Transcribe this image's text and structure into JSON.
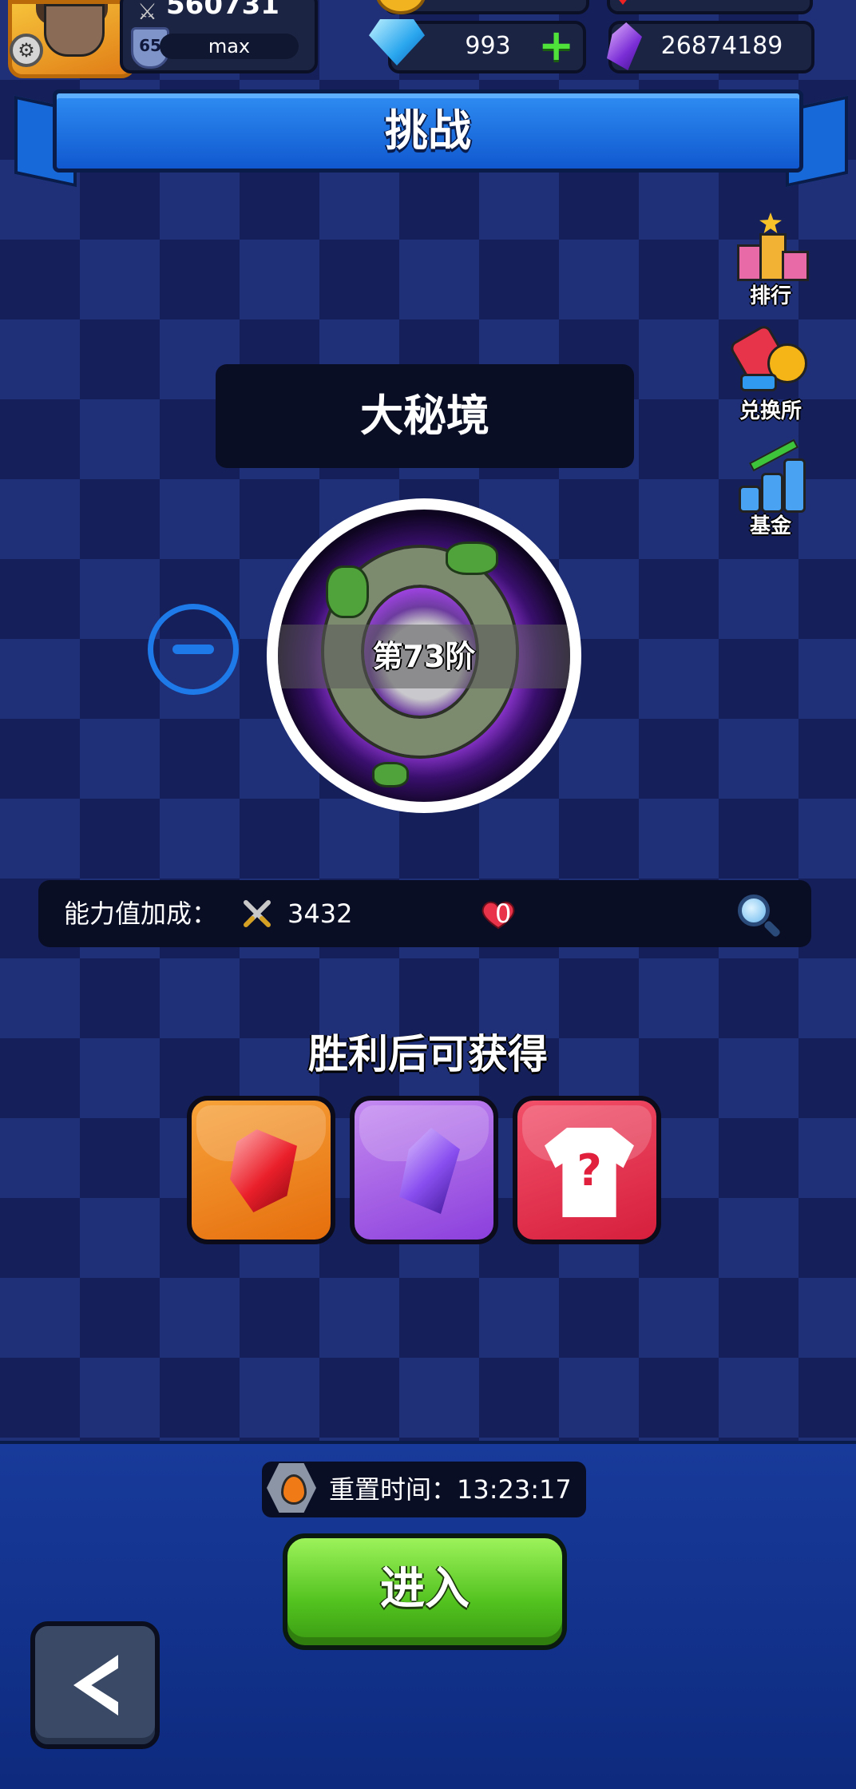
{
  "hud": {
    "power": "560731",
    "level": "65",
    "level_status": "max",
    "diamonds": "993",
    "crystals": "26874189"
  },
  "title": "挑战",
  "side_menu": [
    {
      "label": "排行",
      "icon": "podium-icon"
    },
    {
      "label": "兑换所",
      "icon": "exchange-icon"
    },
    {
      "label": "基金",
      "icon": "fund-chart-icon"
    }
  ],
  "mode": {
    "name": "大秘境",
    "tier": "第73阶"
  },
  "stats": {
    "label": "能力值加成：",
    "attack_bonus": "3432",
    "hp_bonus": "0"
  },
  "rewards": {
    "title": "胜利后可获得",
    "items": [
      {
        "icon": "red-crystal-icon",
        "color": "#f08a1c"
      },
      {
        "icon": "purple-crystal-icon",
        "color": "#9b4fe0"
      },
      {
        "icon": "mystery-armor-icon",
        "color": "#e8304a"
      }
    ]
  },
  "reset": {
    "label": "重置时间：",
    "time": "13:23:17"
  },
  "enter_button": "进入",
  "colors": {
    "accent_blue": "#1d7ae8",
    "enter_green": "#52c21f",
    "panel_dark": "#0a0e25"
  }
}
